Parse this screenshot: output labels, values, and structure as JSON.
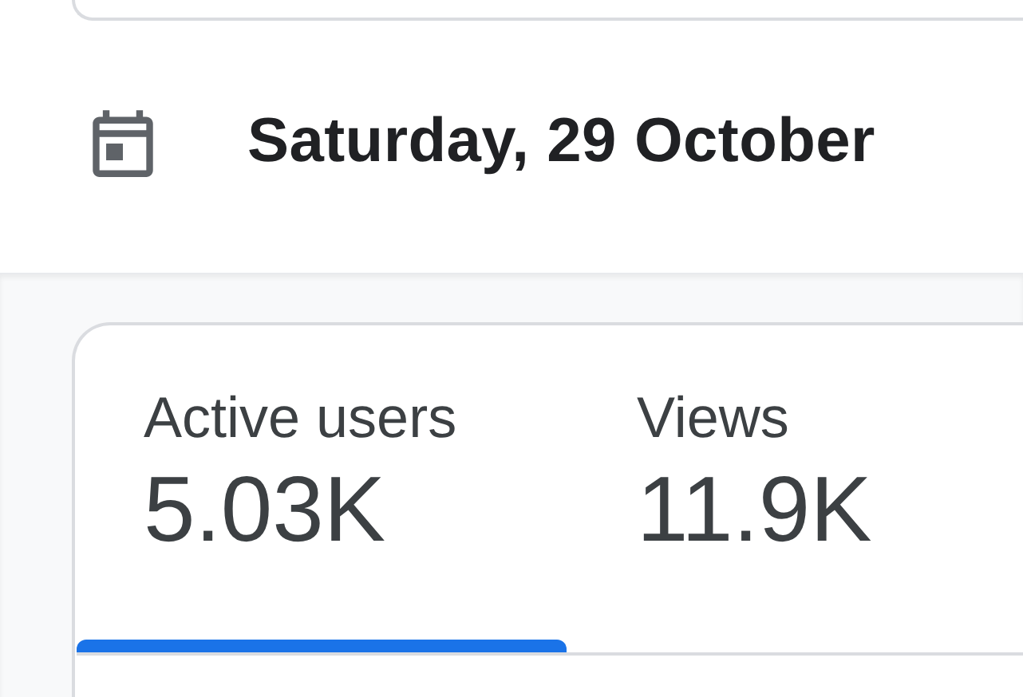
{
  "date": {
    "text": "Saturday, 29 October"
  },
  "metrics": [
    {
      "label": "Active users",
      "value": "5.03K",
      "selected": true
    },
    {
      "label": "Views",
      "value": "11.9K",
      "selected": false
    }
  ]
}
